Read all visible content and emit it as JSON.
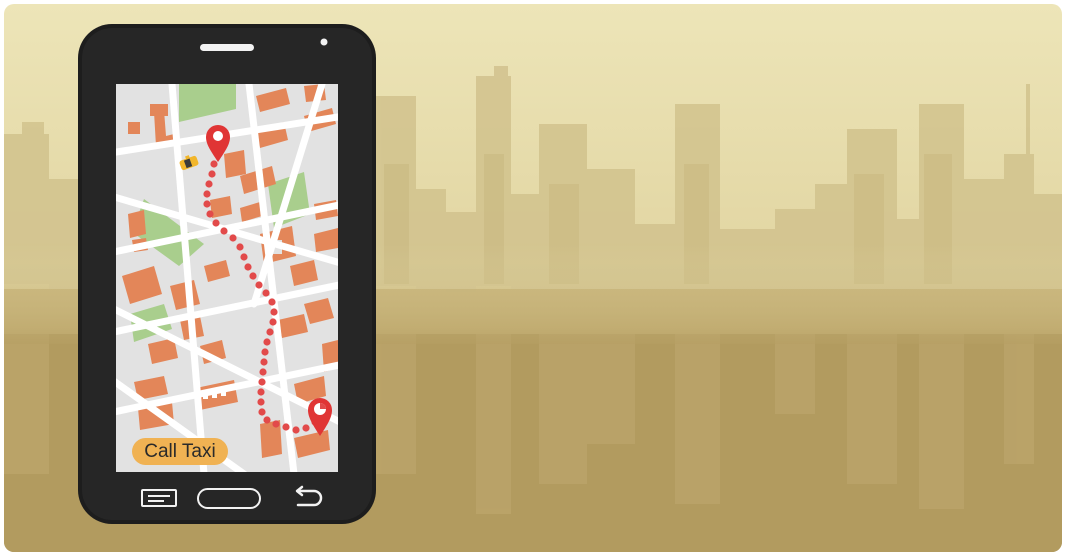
{
  "scene": {
    "colors": {
      "sky_top": "#ece4b6",
      "sky_bottom": "#cdbd85",
      "skyline": "#d2c38f",
      "ground": "#b7a064",
      "phone_body": "#1e1e1e",
      "map_bg": "#e2e2e2",
      "road": "#ffffff",
      "park": "#aacf8f",
      "building": "#e38659",
      "route": "#e24a4a",
      "pin": "#e03535",
      "taxi": "#f2b62a",
      "button_bg": "#f0b253"
    }
  },
  "phone": {
    "map": {
      "call_taxi_label": "Call Taxi"
    },
    "nav_icons": [
      "menu-icon",
      "home-button-icon",
      "back-arrow-icon"
    ]
  }
}
